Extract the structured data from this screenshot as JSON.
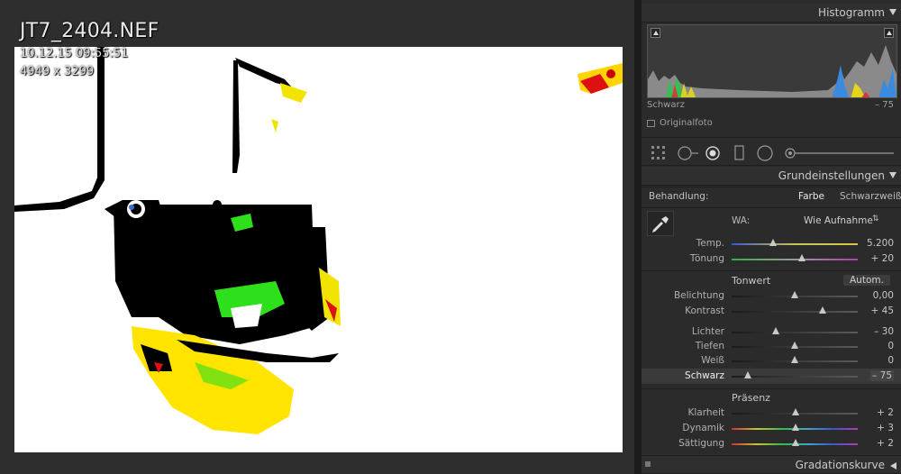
{
  "photo": {
    "filename": "JT7_2404.NEF",
    "datetime": "10.12.15 09:55:51",
    "dimensions": "4949 x 3299"
  },
  "panel": {
    "histogram": {
      "title": "Histogramm",
      "readout_label": "Schwarz",
      "readout_value": "– 75",
      "original_photo": "Originalfoto"
    },
    "basic": {
      "title": "Grundeinstellungen",
      "treatment_label": "Behandlung:",
      "treatment_color": "Farbe",
      "treatment_bw": "Schwarzweiß",
      "wb_label": "WA:",
      "wb_value": "Wie Aufnahme",
      "tone_label": "Tonwert",
      "auto_label": "Autom.",
      "presence_label": "Präsenz",
      "sliders": [
        {
          "label": "Temp.",
          "value": "5.200",
          "pos": 0.33,
          "type": "temp"
        },
        {
          "label": "Tönung",
          "value": "+ 20",
          "pos": 0.56,
          "type": "tint"
        },
        {
          "label": "Belichtung",
          "value": "0,00",
          "pos": 0.5,
          "type": "gray"
        },
        {
          "label": "Kontrast",
          "value": "+ 45",
          "pos": 0.72,
          "type": "gray"
        },
        {
          "label": "Lichter",
          "value": "– 30",
          "pos": 0.35,
          "type": "gray"
        },
        {
          "label": "Tiefen",
          "value": "0",
          "pos": 0.5,
          "type": "gray"
        },
        {
          "label": "Weiß",
          "value": "0",
          "pos": 0.5,
          "type": "gray"
        },
        {
          "label": "Schwarz",
          "value": "– 75",
          "pos": 0.13,
          "type": "gray"
        },
        {
          "label": "Klarheit",
          "value": "+ 2",
          "pos": 0.51,
          "type": "gray"
        },
        {
          "label": "Dynamik",
          "value": "+ 3",
          "pos": 0.51,
          "type": "rainbow"
        },
        {
          "label": "Sättigung",
          "value": "+ 2",
          "pos": 0.51,
          "type": "rainbow"
        }
      ]
    },
    "tone_curve": {
      "title": "Gradationskurve"
    }
  }
}
